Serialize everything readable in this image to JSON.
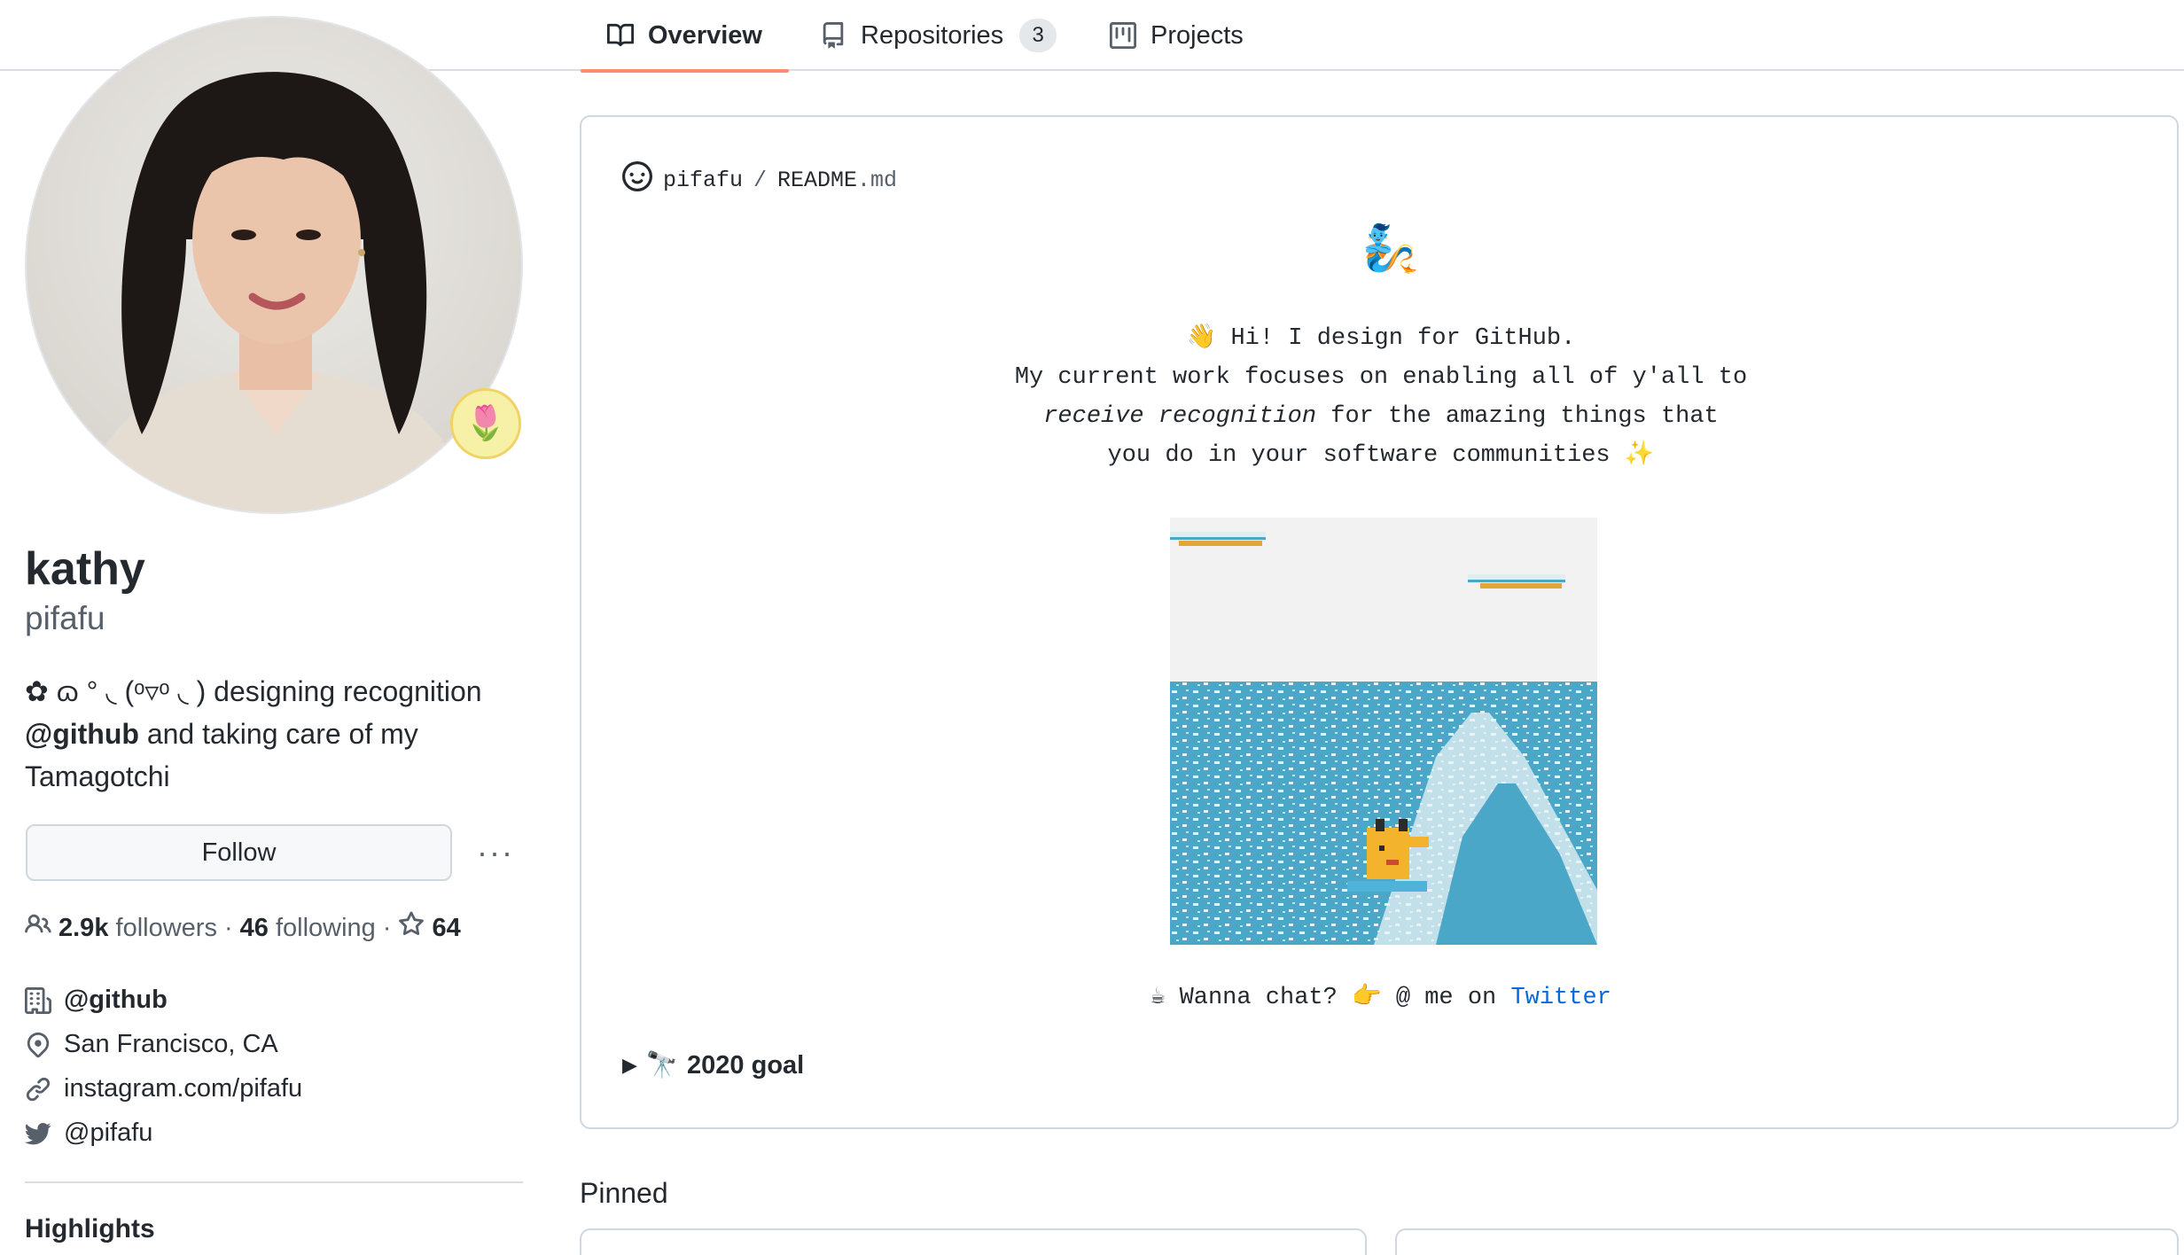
{
  "tabs": [
    {
      "label": "Overview",
      "icon": "book-icon",
      "active": true
    },
    {
      "label": "Repositories",
      "icon": "repo-icon",
      "count": "3"
    },
    {
      "label": "Projects",
      "icon": "project-icon"
    }
  ],
  "profile": {
    "name": "kathy",
    "login": "pifafu",
    "status_emoji": "🌷",
    "bio_prefix": "✿ ɷ ° ◟ (ᵒ▿ᵒ ◟ ) designing recognition",
    "bio_mention": "@github",
    "bio_suffix": " and taking care of my Tamagotchi",
    "follow_label": "Follow",
    "more_label": "···",
    "followers_count": "2.9k",
    "followers_label": "followers",
    "following_count": "46",
    "following_label": "following",
    "stars_count": "64",
    "dot": "·",
    "org": "@github",
    "location": "San Francisco, CA",
    "website": "instagram.com/pifafu",
    "twitter": "@pifafu",
    "highlights_title": "Highlights"
  },
  "readme": {
    "owner": "pifafu",
    "separator": "/",
    "file_base": "README",
    "file_ext": ".md",
    "mascot": "🧞",
    "intro_line1": "👋 Hi! I design for GitHub.",
    "intro_line2": "My current work focuses on enabling all of y'all to",
    "intro_line3_em": "receive recognition",
    "intro_line3_rest": " for the amazing things that",
    "intro_line4": "you do in your software communities ✨",
    "chat_prefix": "☕ Wanna chat? 👉 @ me on ",
    "chat_link": "Twitter",
    "goal_emoji": "🔭",
    "goal_label": "2020 goal"
  },
  "pinned_title": "Pinned",
  "colors": {
    "accent_underline": "#fd8c73",
    "link": "#0969da",
    "muted": "#57606a",
    "border": "#d0d7de"
  }
}
